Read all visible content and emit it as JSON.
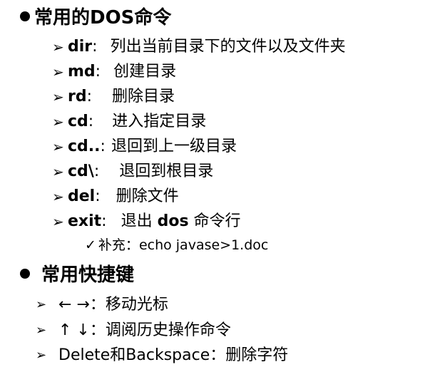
{
  "section_dos": {
    "title": "常用的DOS命令",
    "commands": [
      {
        "cmd": "dir",
        "sep": " :",
        "desc": "列出当前目录下的文件以及文件夹"
      },
      {
        "cmd": "md",
        "sep": " :",
        "desc": "创建目录"
      },
      {
        "cmd": "rd",
        "sep": " :",
        "desc": "删除目录"
      },
      {
        "cmd": "cd",
        "sep": " :",
        "desc": "进入指定目录"
      },
      {
        "cmd": "cd..",
        "sep": " :",
        "desc": "退回到上一级目录"
      },
      {
        "cmd": "cd\\",
        "sep": ":",
        "desc": "退回到根目录"
      },
      {
        "cmd": "del",
        "sep": " :",
        "desc": "删除文件"
      },
      {
        "cmd": "exit",
        "sep": " :",
        "desc_pre": "退出 ",
        "desc_bold": "dos",
        "desc_post": " 命令行"
      }
    ],
    "note": {
      "check": "✓",
      "label": "补充：",
      "text": "echo javase>1.doc"
    }
  },
  "section_shortcuts": {
    "title": "常用快捷键",
    "items": [
      {
        "keys": "←   →：",
        "desc": "移动光标"
      },
      {
        "keys": "↑   ↓：",
        "desc": "调阅历史操作命令"
      },
      {
        "keys": "Delete和Backspace：",
        "desc": "删除字符"
      }
    ]
  },
  "icons": {
    "bullet": "black-circle-bullet-icon",
    "arrow": "arrowhead-bullet-icon",
    "check": "checkmark-icon"
  }
}
